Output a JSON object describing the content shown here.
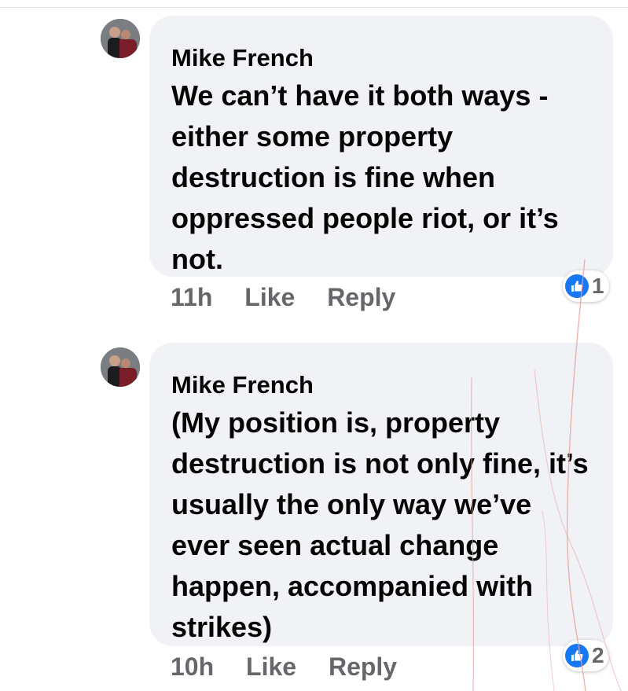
{
  "comments": [
    {
      "author": "Mike French",
      "text": "We can’t have it both ways - either some property destruction is fine when oppressed people riot, or it’s not.",
      "time": "11h",
      "like_label": "Like",
      "reply_label": "Reply",
      "reaction_icon": "like-icon",
      "reaction_count": "1"
    },
    {
      "author": "Mike French",
      "text": "(My position is, property destruction is not only fine, it’s usually the only way we’ve ever seen actual change happen, accompanied with strikes)",
      "time": "10h",
      "like_label": "Like",
      "reply_label": "Reply",
      "reaction_icon": "like-icon",
      "reaction_count": "2"
    }
  ],
  "colors": {
    "bubble": "#f0f2f5",
    "meta_text": "#65676b",
    "like_blue": "#1877f2",
    "scratch_line": "#e8a0a0"
  }
}
